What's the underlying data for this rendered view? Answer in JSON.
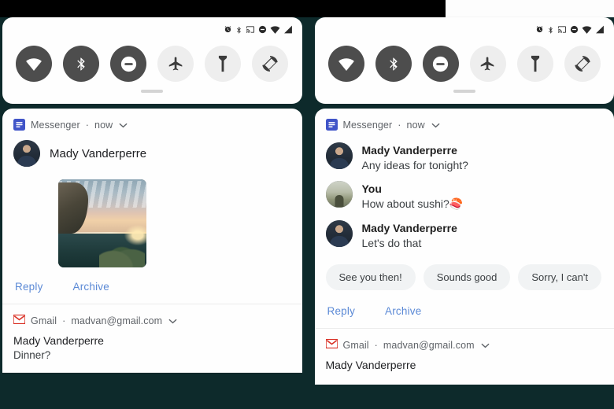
{
  "statusbar": {
    "icons": [
      "alarm-icon",
      "bluetooth-icon",
      "cast-icon",
      "do-not-disturb-icon",
      "wifi-icon",
      "signal-icon"
    ]
  },
  "quick_settings": {
    "toggles": [
      {
        "name": "wifi-toggle",
        "icon": "wifi-icon",
        "state": "on"
      },
      {
        "name": "bluetooth-toggle",
        "icon": "bluetooth-icon",
        "state": "on"
      },
      {
        "name": "dnd-toggle",
        "icon": "do-not-disturb-icon",
        "state": "on"
      },
      {
        "name": "airplane-toggle",
        "icon": "airplane-icon",
        "state": "off"
      },
      {
        "name": "flashlight-toggle",
        "icon": "flashlight-icon",
        "state": "off"
      },
      {
        "name": "auto-rotate-toggle",
        "icon": "auto-rotate-icon",
        "state": "off"
      }
    ]
  },
  "colors": {
    "link": "#5c8ad6",
    "messenger_blue": "#4054c8",
    "gmail_red": "#d93025",
    "toggle_on": "#4d4d4d",
    "toggle_off": "#eeeeee",
    "backdrop": "#0d2a2b"
  },
  "left_panel": {
    "messenger": {
      "app_name": "Messenger",
      "separator": "·",
      "time": "now",
      "sender": "Mady Vanderperre",
      "attachment": "photo-attachment",
      "actions": [
        "Reply",
        "Archive"
      ]
    },
    "gmail": {
      "app_name": "Gmail",
      "separator": "·",
      "account": "madvan@gmail.com",
      "title": "Mady Vanderperre",
      "subject": "Dinner?"
    }
  },
  "right_panel": {
    "messenger": {
      "app_name": "Messenger",
      "separator": "·",
      "time": "now",
      "messages": [
        {
          "sender": "Mady Vanderperre",
          "text": "Any ideas for tonight?",
          "avatar": "person"
        },
        {
          "sender": "You",
          "text": "How about sushi?",
          "emoji": "🍣",
          "avatar": "scenery"
        },
        {
          "sender": "Mady Vanderperre",
          "text": "Let's do that",
          "avatar": "person"
        }
      ],
      "smart_replies": [
        "See you then!",
        "Sounds good",
        "Sorry, I can't"
      ],
      "actions": [
        "Reply",
        "Archive"
      ]
    },
    "gmail": {
      "app_name": "Gmail",
      "separator": "·",
      "account": "madvan@gmail.com",
      "title": "Mady Vanderperre"
    }
  }
}
